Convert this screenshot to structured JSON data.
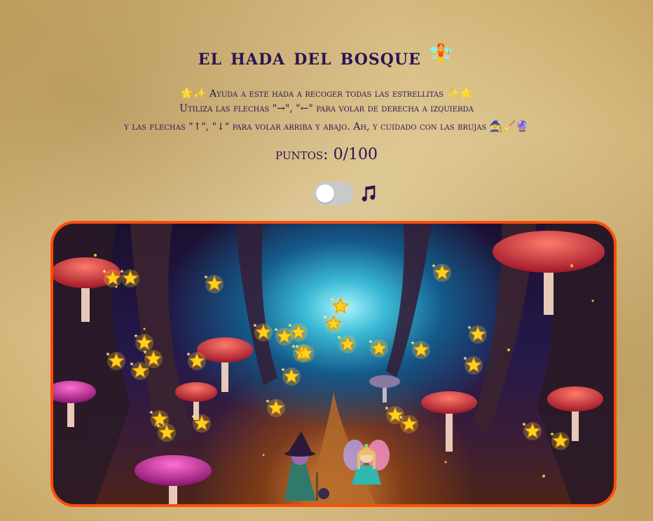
{
  "title": "el hada del bosque",
  "title_icon": "fairy-icon",
  "instructions": {
    "line1": "Ayuda a este hada a recoger todas las estrellitas",
    "line2": "Utiliza las flechas \"→\", \"←\" para volar de derecha a izquierda",
    "line3": "y las flechas \"↑\", \"↓\" para volar arriba y abajo. Ah, y cuidado con las brujas"
  },
  "score": {
    "label": "puntos:",
    "value": "0/100"
  },
  "music_toggle": {
    "on": false,
    "icon": "music-note-icon"
  },
  "game": {
    "player": "fairy-sprite",
    "enemy": "witch-sprite",
    "item": "star-icon",
    "star_count": 32
  },
  "colors": {
    "frame": "#ff4c0a",
    "text": "#2a1454",
    "star": "#ffd21f"
  }
}
